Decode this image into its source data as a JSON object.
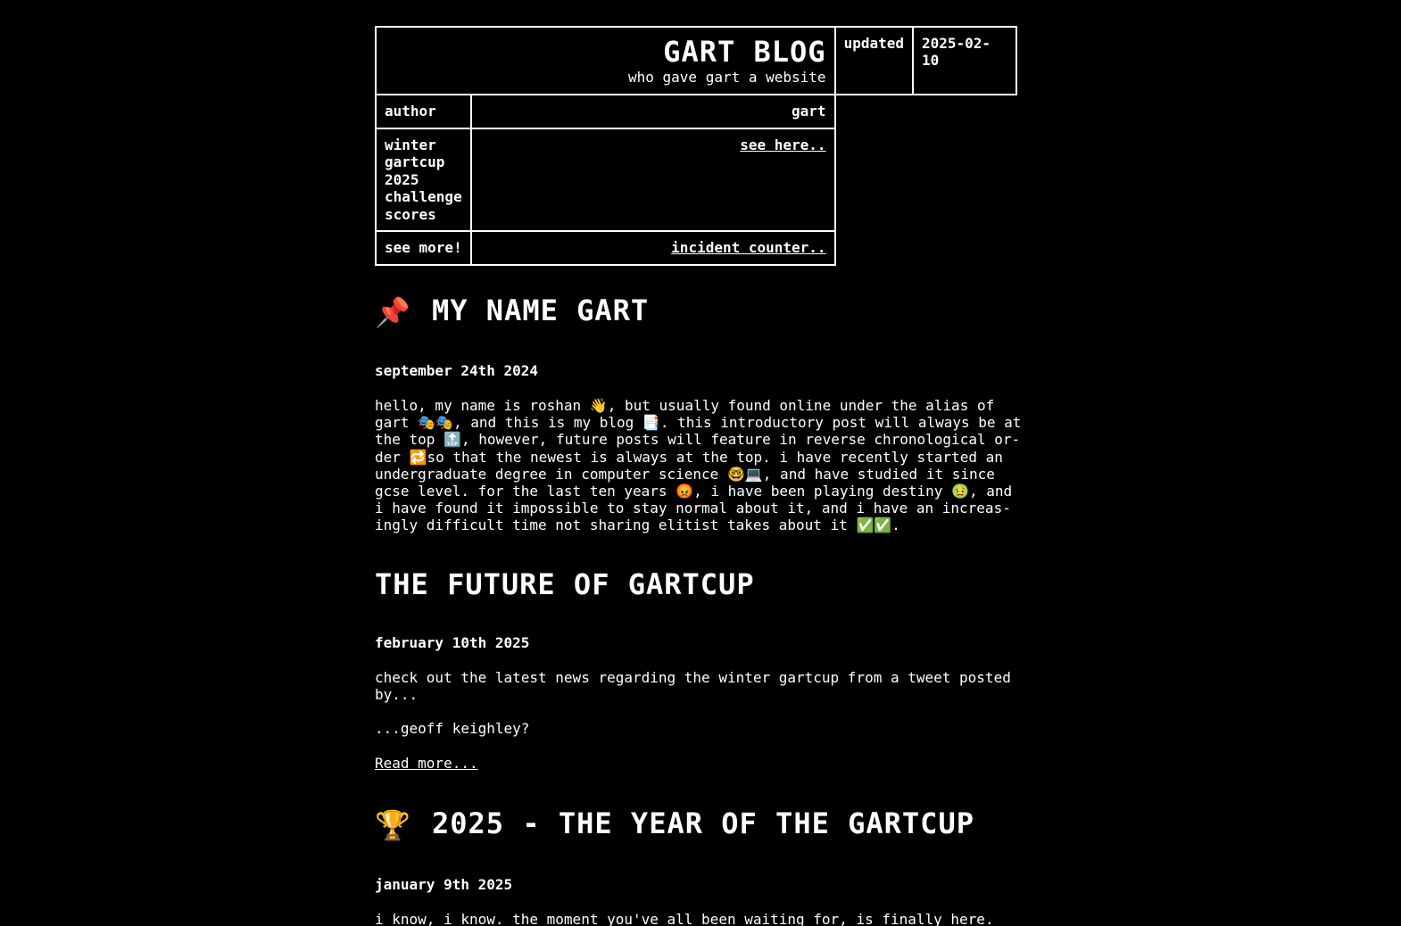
{
  "header": {
    "title": "GART BLOG",
    "subtitle": "who gave gart a website",
    "updated_label": "updated",
    "updated_value": "2025-02-10",
    "rows": [
      {
        "label": "author",
        "value": "gart"
      },
      {
        "label": "winter gartcup 2025 challenge scores",
        "value": "see here.."
      },
      {
        "label": "see more!",
        "value": "incident counter.."
      }
    ]
  },
  "posts": [
    {
      "title": "MY NAME GART",
      "icon": "📌",
      "date": "september 24th 2024",
      "body": "hello, my name is roshan 👋, but usually found online under the alias of gart 🎭🎭, and this is my blog 📑. this introductory post will always be at the top 🔝, however, future posts will feature in reverse chronological or-der 🔁so that the newest is always at the top. i have recently started an undergraduate degree in computer science 🤓💻, and have studied it since gcse level. for the last ten years 😡, i have been playing destiny 🤢, and i have found it impossible to stay normal about it, and i have an increas-ingly difficult time not sharing elitist takes about it ✅✅."
    },
    {
      "title": "THE FUTURE OF GARTCUP",
      "date": "february 10th 2025",
      "body1": "check out the latest news regarding the winter gartcup from a tweet posted by...",
      "body2": "...geoff keighley?",
      "read_more": "Read more..."
    },
    {
      "title": "2025 - THE YEAR OF THE GARTCUP",
      "icon": "🏆",
      "date": "january 9th 2025",
      "body": "i know, i know. the moment you've all been waiting for, is finally here."
    }
  ]
}
